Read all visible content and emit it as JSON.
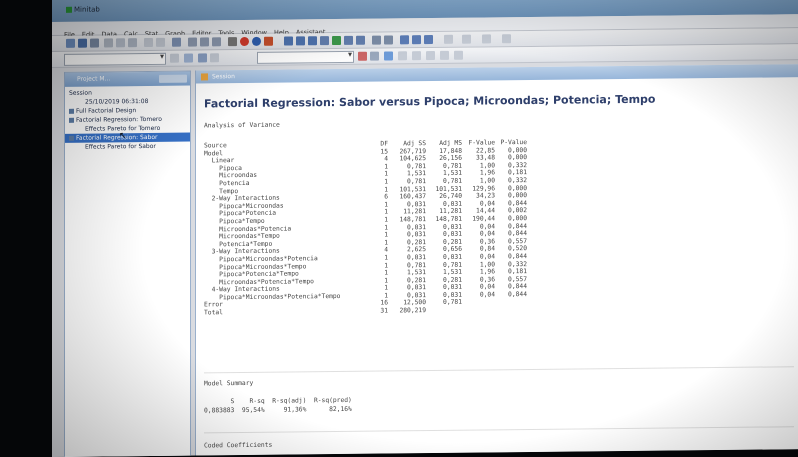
{
  "app": {
    "title": "Minitab"
  },
  "menu": [
    "File",
    "Edit",
    "Data",
    "Calc",
    "Stat",
    "Graph",
    "Editor",
    "Tools",
    "Window",
    "Help",
    "Assistant"
  ],
  "project_manager": {
    "title": "Project M...",
    "items": [
      {
        "label": "Session",
        "indent": false,
        "selected": false
      },
      {
        "label": "25/10/2019 06:31:08",
        "indent": true,
        "selected": false
      },
      {
        "label": "Full Factorial Design",
        "indent": false,
        "selected": false
      },
      {
        "label": "Factorial Regression: Tomero",
        "indent": false,
        "selected": false
      },
      {
        "label": "Effects Pareto for Tomero",
        "indent": true,
        "selected": false
      },
      {
        "label": "Factorial Regression: Sabor",
        "indent": false,
        "selected": true
      },
      {
        "label": "Effects Pareto for Sabor",
        "indent": true,
        "selected": false
      }
    ]
  },
  "session": {
    "window_title": "Session",
    "report_title": "Factorial Regression: Sabor versus Pipoca; Microondas; Potencia; Tempo",
    "aov_heading": "Analysis of Variance",
    "aov_columns": [
      "Source",
      "DF",
      "Adj SS",
      "Adj MS",
      "F-Value",
      "P-Value"
    ],
    "aov_rows": [
      [
        "Model",
        "15",
        "267,719",
        "17,848",
        "22,85",
        "0,000"
      ],
      [
        "  Linear",
        "4",
        "104,625",
        "26,156",
        "33,48",
        "0,000"
      ],
      [
        "    Pipoca",
        "1",
        "0,781",
        "0,781",
        "1,00",
        "0,332"
      ],
      [
        "    Microondas",
        "1",
        "1,531",
        "1,531",
        "1,96",
        "0,181"
      ],
      [
        "    Potencia",
        "1",
        "0,781",
        "0,781",
        "1,00",
        "0,332"
      ],
      [
        "    Tempo",
        "1",
        "101,531",
        "101,531",
        "129,96",
        "0,000"
      ],
      [
        "  2-Way Interactions",
        "6",
        "160,437",
        "26,740",
        "34,23",
        "0,000"
      ],
      [
        "    Pipoca*Microondas",
        "1",
        "0,031",
        "0,031",
        "0,04",
        "0,844"
      ],
      [
        "    Pipoca*Potencia",
        "1",
        "11,281",
        "11,281",
        "14,44",
        "0,002"
      ],
      [
        "    Pipoca*Tempo",
        "1",
        "148,781",
        "148,781",
        "190,44",
        "0,000"
      ],
      [
        "    Microondas*Potencia",
        "1",
        "0,031",
        "0,031",
        "0,04",
        "0,844"
      ],
      [
        "    Microondas*Tempo",
        "1",
        "0,031",
        "0,031",
        "0,04",
        "0,844"
      ],
      [
        "    Potencia*Tempo",
        "1",
        "0,281",
        "0,281",
        "0,36",
        "0,557"
      ],
      [
        "  3-Way Interactions",
        "4",
        "2,625",
        "0,656",
        "0,84",
        "0,520"
      ],
      [
        "    Pipoca*Microondas*Potencia",
        "1",
        "0,031",
        "0,031",
        "0,04",
        "0,844"
      ],
      [
        "    Pipoca*Microondas*Tempo",
        "1",
        "0,781",
        "0,781",
        "1,00",
        "0,332"
      ],
      [
        "    Pipoca*Potencia*Tempo",
        "1",
        "1,531",
        "1,531",
        "1,96",
        "0,181"
      ],
      [
        "    Microondas*Potencia*Tempo",
        "1",
        "0,281",
        "0,281",
        "0,36",
        "0,557"
      ],
      [
        "  4-Way Interactions",
        "1",
        "0,031",
        "0,031",
        "0,04",
        "0,844"
      ],
      [
        "    Pipoca*Microondas*Potencia*Tempo",
        "1",
        "0,031",
        "0,031",
        "0,04",
        "0,844"
      ],
      [
        "Error",
        "16",
        "12,500",
        "0,781",
        "",
        ""
      ],
      [
        "Total",
        "31",
        "280,219",
        "",
        "",
        ""
      ]
    ],
    "model_summary_heading": "Model Summary",
    "model_summary_header": "       S    R-sq  R-sq(adj)  R-sq(pred)",
    "model_summary_values": "0,883883  95,54%     91,36%      82,16%",
    "coded_coefficients_heading": "Coded Coefficients"
  }
}
